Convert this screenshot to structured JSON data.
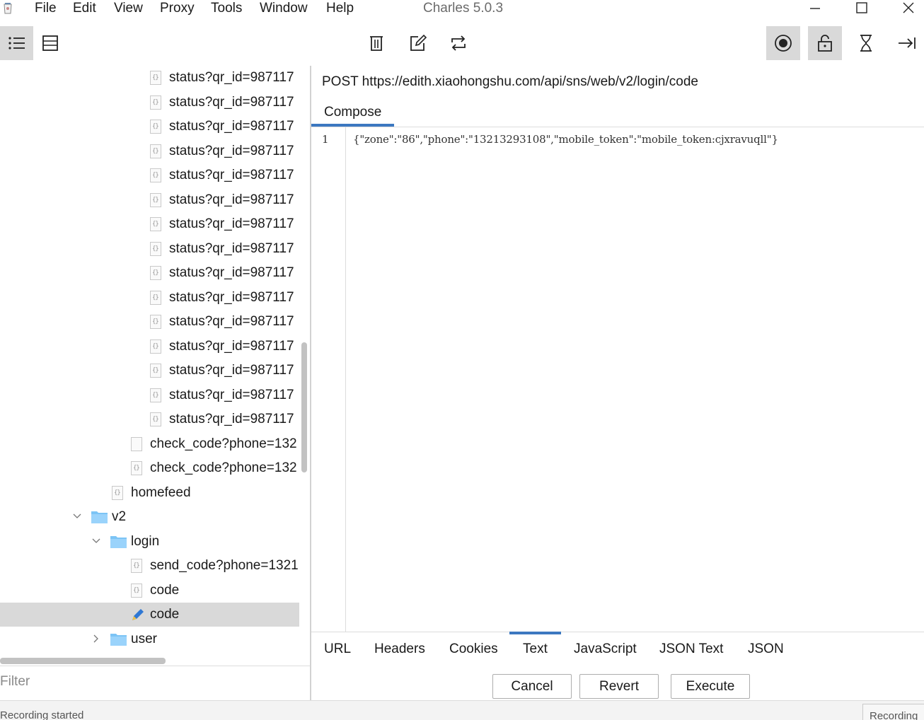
{
  "app": {
    "title": "Charles 5.0.3"
  },
  "menu": [
    "File",
    "Edit",
    "View",
    "Proxy",
    "Tools",
    "Window",
    "Help"
  ],
  "tree": {
    "status_rows": [
      "status?qr_id=987117",
      "status?qr_id=987117",
      "status?qr_id=987117",
      "status?qr_id=987117",
      "status?qr_id=987117",
      "status?qr_id=987117",
      "status?qr_id=987117",
      "status?qr_id=987117",
      "status?qr_id=987117",
      "status?qr_id=987117",
      "status?qr_id=987117",
      "status?qr_id=987117",
      "status?qr_id=987117",
      "status?qr_id=987117",
      "status?qr_id=987117"
    ],
    "check_code_1": "check_code?phone=132",
    "check_code_2": "check_code?phone=132",
    "homefeed": "homefeed",
    "v2": "v2",
    "login": "login",
    "send_code": "send_code?phone=1321",
    "code_1": "code",
    "code_2": "code",
    "user": "user"
  },
  "filter": {
    "placeholder": "Filter"
  },
  "request": {
    "line": "POST https://edith.xiaohongshu.com/api/sns/web/v2/login/code",
    "compose_tab": "Compose",
    "line_number": "1",
    "body": "{\"zone\":\"86\",\"phone\":\"13213293108\",\"mobile_token\":\"mobile_token:cjxravuqll\"}"
  },
  "bottom_tabs": [
    "URL",
    "Headers",
    "Cookies",
    "Text",
    "JavaScript",
    "JSON Text",
    "JSON"
  ],
  "active_bottom_tab": "Text",
  "buttons": {
    "cancel": "Cancel",
    "revert": "Revert",
    "execute": "Execute"
  },
  "status": {
    "left": "Recording started",
    "right": "Recording"
  },
  "colors": {
    "accent": "#3c78c0",
    "selected_bg": "#d9d9d9",
    "folder": "#7cc4f5"
  }
}
